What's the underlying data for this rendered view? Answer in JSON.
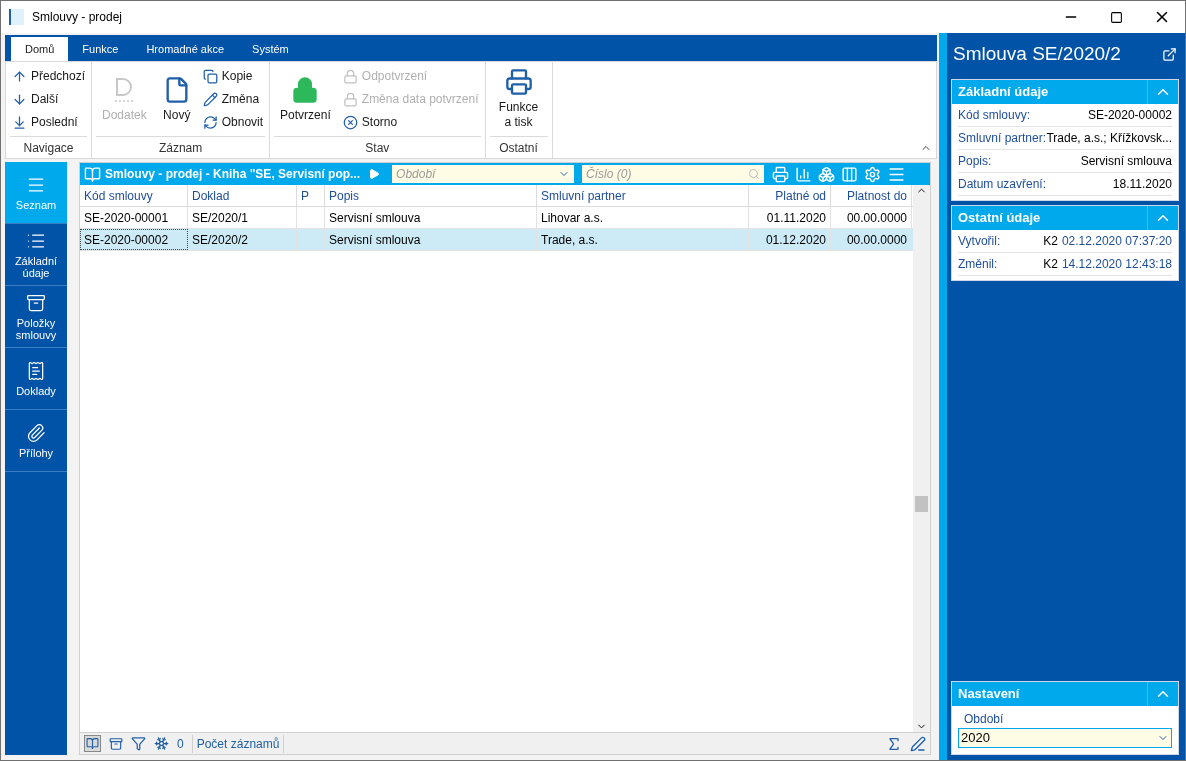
{
  "window": {
    "title": "Smlouvy - prodej"
  },
  "ribbon_tabs": [
    {
      "label": "Domů",
      "selected": true
    },
    {
      "label": "Funkce",
      "selected": false
    },
    {
      "label": "Hromadné akce",
      "selected": false
    },
    {
      "label": "Systém",
      "selected": false
    }
  ],
  "ribbon_groups": [
    {
      "label": "Navigace",
      "items": [
        {
          "kind": "small",
          "label": "Předchozí",
          "disabled": false
        },
        {
          "kind": "small",
          "label": "Další",
          "disabled": false
        },
        {
          "kind": "small",
          "label": "Poslední",
          "disabled": false
        }
      ]
    },
    {
      "label": "Záznam",
      "items": [
        {
          "kind": "large",
          "label": "Dodatek",
          "disabled": true
        },
        {
          "kind": "large",
          "label": "Nový",
          "disabled": false
        },
        {
          "kind": "small",
          "label": "Kopie",
          "disabled": false
        },
        {
          "kind": "small",
          "label": "Změna",
          "disabled": false
        },
        {
          "kind": "small",
          "label": "Obnovit",
          "disabled": false
        }
      ]
    },
    {
      "label": "Stav",
      "items": [
        {
          "kind": "large",
          "label": "Potvrzení",
          "disabled": false
        },
        {
          "kind": "small",
          "label": "Odpotvrzení",
          "disabled": true
        },
        {
          "kind": "small",
          "label": "Změna data potvrzení",
          "disabled": true
        },
        {
          "kind": "small",
          "label": "Storno",
          "disabled": false
        }
      ]
    },
    {
      "label": "Ostatní",
      "items": [
        {
          "kind": "large",
          "label": "Funkce a tisk",
          "disabled": false
        }
      ]
    }
  ],
  "side_nav": [
    {
      "label": "Seznam",
      "selected": true
    },
    {
      "label": "Základní údaje",
      "selected": false
    },
    {
      "label": "Položky smlouvy",
      "selected": false
    },
    {
      "label": "Doklady",
      "selected": false
    },
    {
      "label": "Přílohy",
      "selected": false
    }
  ],
  "grid": {
    "title": "Smlouvy - prodej - Kniha \"SE, Servisní pop...",
    "period_field": {
      "placeholder": "Období"
    },
    "number_field": {
      "placeholder": "Číslo (0)"
    },
    "columns": [
      {
        "label": "Kód smlouvy"
      },
      {
        "label": "Doklad"
      },
      {
        "label": "P"
      },
      {
        "label": "Popis"
      },
      {
        "label": "Smluvní partner"
      },
      {
        "label": "Platné od"
      },
      {
        "label": "Platnost do"
      }
    ],
    "rows": [
      {
        "selected": false,
        "cells": [
          "SE-2020-00001",
          "SE/2020/1",
          "",
          "Servisní smlouva",
          "Lihovar a.s.",
          "01.11.2020",
          "00.00.0000"
        ]
      },
      {
        "selected": true,
        "cells": [
          "SE-2020-00002",
          "SE/2020/2",
          "",
          "Servisní smlouva",
          "Trade, a.s.",
          "01.12.2020",
          "00.00.0000"
        ]
      }
    ],
    "footer": {
      "count": "0",
      "count_label": "Počet záznamů"
    }
  },
  "detail": {
    "title": "Smlouva SE/2020/2",
    "sections": [
      {
        "title": "Základní údaje",
        "expanded": true,
        "fields": [
          {
            "label": "Kód smlouvy:",
            "value": "SE-2020-00002"
          },
          {
            "label": "Smluvní partner:",
            "value": "Trade, a.s.; Křížkovsk..."
          },
          {
            "label": "Popis:",
            "value": "Servisní smlouva"
          },
          {
            "label": "Datum uzavření:",
            "value": "18.11.2020"
          }
        ]
      },
      {
        "title": "Ostatní údaje",
        "expanded": true,
        "fields": [
          {
            "label": "Vytvořil:",
            "user": "K2",
            "value": "02.12.2020 07:37:20"
          },
          {
            "label": "Změnil:",
            "user": "K2",
            "value": "14.12.2020 12:43:18"
          }
        ]
      }
    ],
    "settings": {
      "title": "Nastavení",
      "expanded": true,
      "field_label": "Období",
      "field_value": "2020"
    }
  }
}
